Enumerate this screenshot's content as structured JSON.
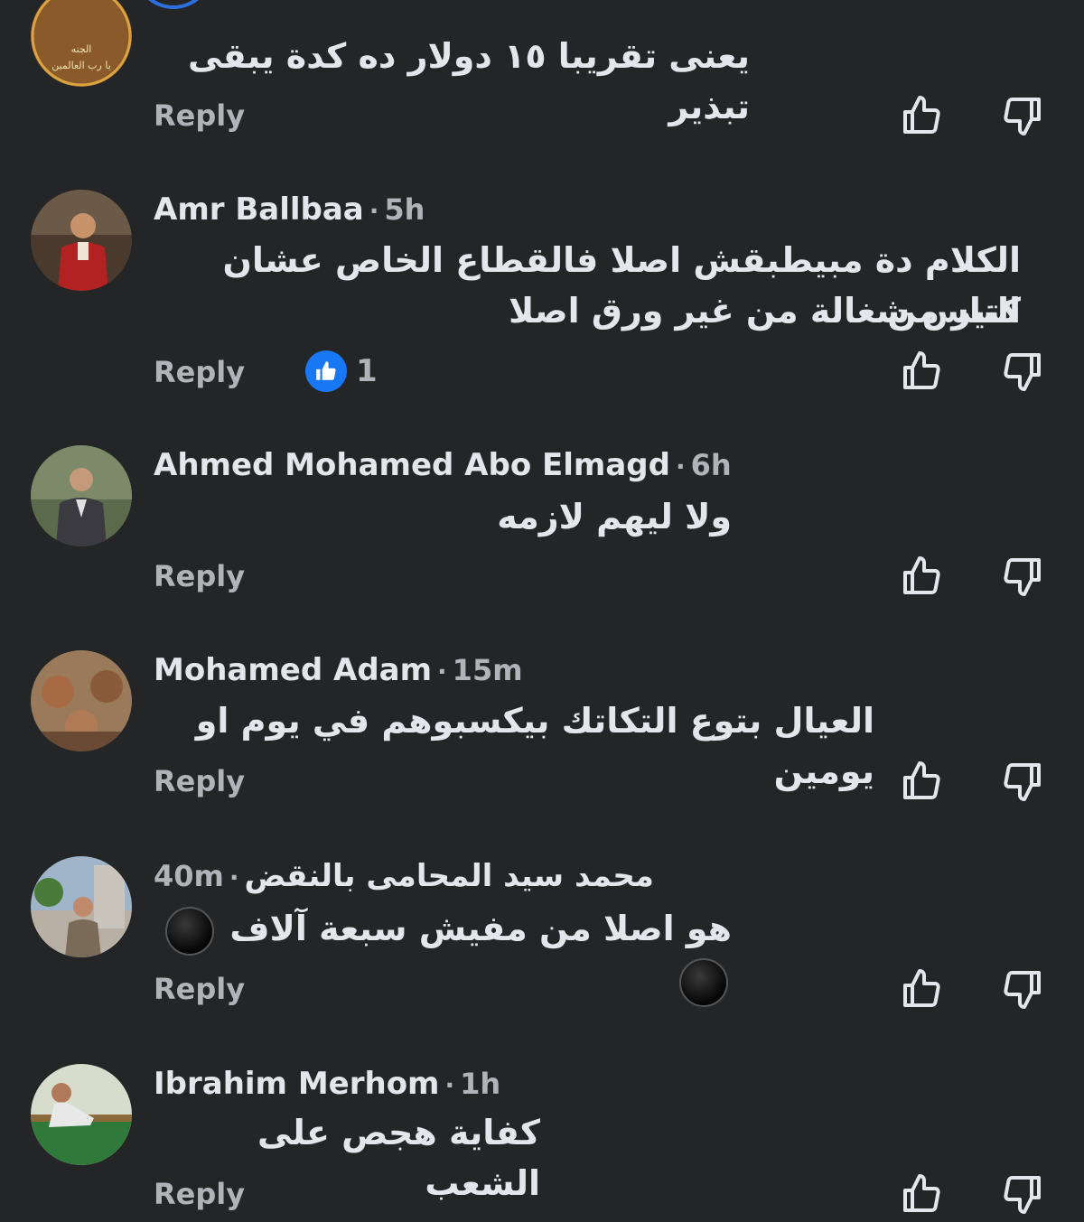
{
  "comments": [
    {
      "author": "",
      "time": "",
      "text": "يعنى تقريبا ١٥ دولار ده كدة يبقى تبذير",
      "reply_label": "Reply",
      "avatar_caption": "يا رب العالمين"
    },
    {
      "author": "Amr Ballbaa",
      "time": "5h",
      "text_lines": [
        "الكلام دة مبيطبقش اصلا فالقطاع الخاص عشان كتير من",
        "الناس شغالة من غير ورق اصلا"
      ],
      "reply_label": "Reply",
      "like_count": "1"
    },
    {
      "author": "Ahmed Mohamed Abo Elmagd",
      "time": "6h",
      "text": "ولا ليهم لازمه",
      "reply_label": "Reply"
    },
    {
      "author": "Mohamed Adam",
      "time": "15m",
      "text": "العيال بتوع التكاتك بيكسبوهم في يوم او يومين",
      "reply_label": "Reply"
    },
    {
      "author": "محمد سيد المحامى بالنقض",
      "time": "40m",
      "text": "هو اصلا من مفيش سبعة آلاف",
      "reply_label": "Reply"
    },
    {
      "author": "Ibrahim Merhom",
      "time": "1h",
      "text": "كفاية هجص على الشعب",
      "reply_label": "Reply"
    }
  ],
  "icons": {
    "like": "thumbs-up-outline-icon",
    "dislike": "thumbs-down-outline-icon",
    "reaction": "like-reaction-icon",
    "emoji": "black-circle-emoji"
  },
  "colors": {
    "background": "#242526",
    "text_primary": "#e4e6eb",
    "text_secondary": "#b0b3b8",
    "like_blue": "#1877f2"
  }
}
